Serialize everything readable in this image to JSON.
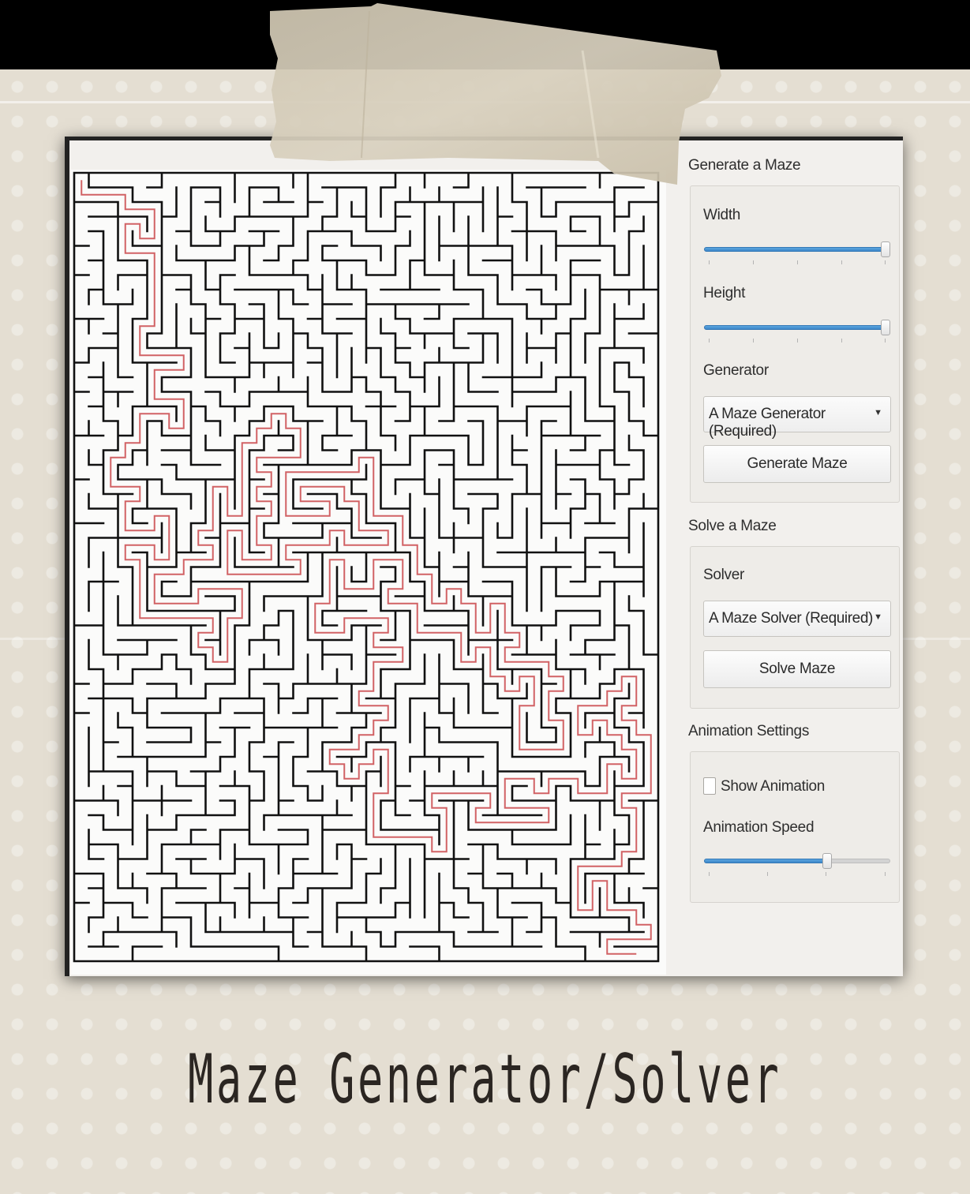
{
  "panel": {
    "generate": {
      "title": "Generate a Maze",
      "width_label": "Width",
      "width_value": 1.0,
      "height_label": "Height",
      "height_value": 1.0,
      "generator_label": "Generator",
      "generator_selected": "A Maze Generator (Required)",
      "generate_button": "Generate Maze"
    },
    "solve": {
      "title": "Solve a Maze",
      "solver_label": "Solver",
      "solver_selected": "A Maze Solver (Required)",
      "solve_button": "Solve Maze"
    },
    "animation": {
      "title": "Animation Settings",
      "show_animation_label": "Show Animation",
      "show_animation_checked": false,
      "speed_label": "Animation Speed",
      "speed_value": 0.67
    }
  },
  "caption": "Maze Generator/Solver",
  "colors": {
    "slider_fill": "#3c86c9",
    "maze_wall": "#111111",
    "solution_path": "#c9474a",
    "background": "#e4ded2"
  },
  "icons": [
    "chevron-down-icon",
    "checkbox-icon"
  ]
}
